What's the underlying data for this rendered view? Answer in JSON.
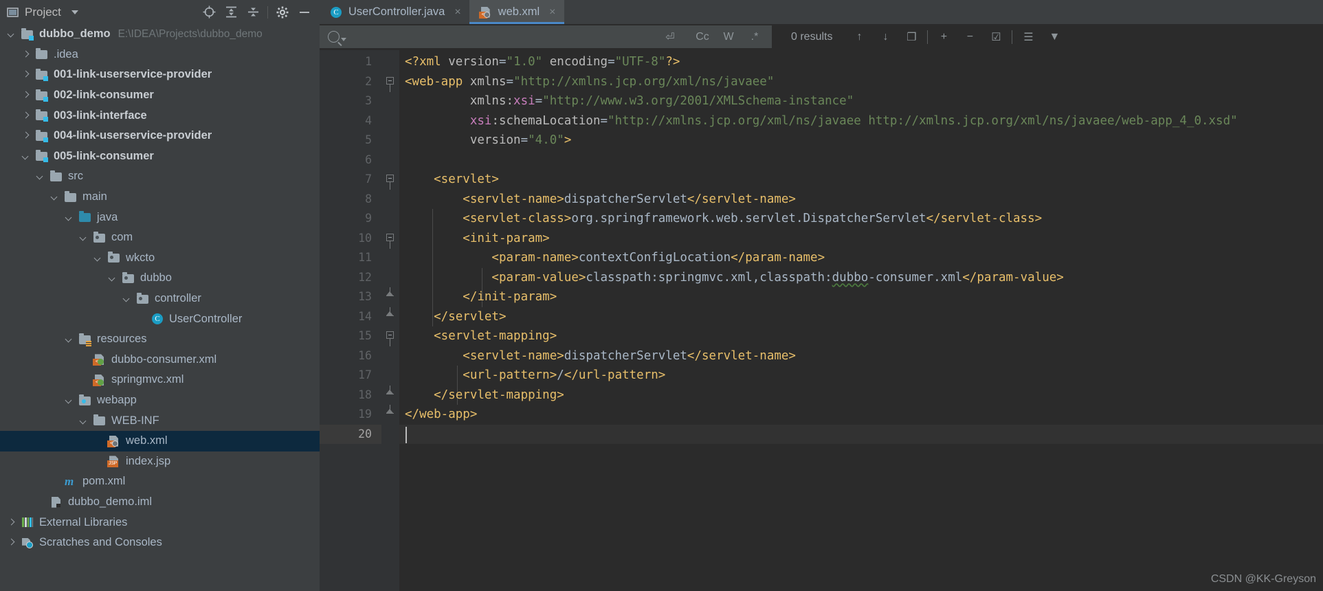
{
  "project_panel": {
    "title": "Project",
    "toolbar": [
      {
        "name": "locate-icon",
        "label": "⊕"
      },
      {
        "name": "expand-all-icon",
        "label": "⤒"
      },
      {
        "name": "collapse-all-icon",
        "label": "⤓"
      },
      {
        "name": "settings-gear-icon",
        "label": "⚙"
      },
      {
        "name": "hide-panel-icon",
        "label": "—"
      }
    ],
    "tree": [
      {
        "label": "dubbo_demo",
        "sublabel": "E:\\IDEA\\Projects\\dubbo_demo",
        "indent": 0,
        "twisty": "down",
        "icon": "module-folder-icon",
        "bold": true,
        "selected": false
      },
      {
        "label": ".idea",
        "sublabel": "",
        "indent": 1,
        "twisty": "right",
        "icon": "folder-icon",
        "bold": false,
        "selected": false
      },
      {
        "label": "001-link-userservice-provider",
        "sublabel": "",
        "indent": 1,
        "twisty": "right",
        "icon": "module-folder-icon",
        "bold": true,
        "selected": false
      },
      {
        "label": "002-link-consumer",
        "sublabel": "",
        "indent": 1,
        "twisty": "right",
        "icon": "module-folder-icon",
        "bold": true,
        "selected": false
      },
      {
        "label": "003-link-interface",
        "sublabel": "",
        "indent": 1,
        "twisty": "right",
        "icon": "module-folder-icon",
        "bold": true,
        "selected": false
      },
      {
        "label": "004-link-userservice-provider",
        "sublabel": "",
        "indent": 1,
        "twisty": "right",
        "icon": "module-folder-icon",
        "bold": true,
        "selected": false
      },
      {
        "label": "005-link-consumer",
        "sublabel": "",
        "indent": 1,
        "twisty": "down",
        "icon": "module-folder-icon",
        "bold": true,
        "selected": false
      },
      {
        "label": "src",
        "sublabel": "",
        "indent": 2,
        "twisty": "down",
        "icon": "folder-icon",
        "bold": false,
        "selected": false
      },
      {
        "label": "main",
        "sublabel": "",
        "indent": 3,
        "twisty": "down",
        "icon": "folder-icon",
        "bold": false,
        "selected": false
      },
      {
        "label": "java",
        "sublabel": "",
        "indent": 4,
        "twisty": "down",
        "icon": "source-folder-icon",
        "bold": false,
        "selected": false
      },
      {
        "label": "com",
        "sublabel": "",
        "indent": 5,
        "twisty": "down",
        "icon": "package-icon",
        "bold": false,
        "selected": false
      },
      {
        "label": "wkcto",
        "sublabel": "",
        "indent": 6,
        "twisty": "down",
        "icon": "package-icon",
        "bold": false,
        "selected": false
      },
      {
        "label": "dubbo",
        "sublabel": "",
        "indent": 7,
        "twisty": "down",
        "icon": "package-icon",
        "bold": false,
        "selected": false
      },
      {
        "label": "controller",
        "sublabel": "",
        "indent": 8,
        "twisty": "down",
        "icon": "package-icon",
        "bold": false,
        "selected": false
      },
      {
        "label": "UserController",
        "sublabel": "",
        "indent": 9,
        "twisty": "none",
        "icon": "java-class-icon",
        "bold": false,
        "selected": false
      },
      {
        "label": "resources",
        "sublabel": "",
        "indent": 4,
        "twisty": "down",
        "icon": "resources-folder-icon",
        "bold": false,
        "selected": false
      },
      {
        "label": "dubbo-consumer.xml",
        "sublabel": "",
        "indent": 5,
        "twisty": "none",
        "icon": "spring-xml-icon",
        "bold": false,
        "selected": false
      },
      {
        "label": "springmvc.xml",
        "sublabel": "",
        "indent": 5,
        "twisty": "none",
        "icon": "spring-xml-icon",
        "bold": false,
        "selected": false
      },
      {
        "label": "webapp",
        "sublabel": "",
        "indent": 4,
        "twisty": "down",
        "icon": "web-folder-icon",
        "bold": false,
        "selected": false
      },
      {
        "label": "WEB-INF",
        "sublabel": "",
        "indent": 5,
        "twisty": "down",
        "icon": "folder-icon",
        "bold": false,
        "selected": false
      },
      {
        "label": "web.xml",
        "sublabel": "",
        "indent": 6,
        "twisty": "none",
        "icon": "web-xml-icon",
        "bold": false,
        "selected": true
      },
      {
        "label": "index.jsp",
        "sublabel": "",
        "indent": 6,
        "twisty": "none",
        "icon": "jsp-icon",
        "bold": false,
        "selected": false
      },
      {
        "label": "pom.xml",
        "sublabel": "",
        "indent": 3,
        "twisty": "none",
        "icon": "maven-icon",
        "bold": false,
        "selected": false
      },
      {
        "label": "dubbo_demo.iml",
        "sublabel": "",
        "indent": 2,
        "twisty": "none",
        "icon": "iml-icon",
        "bold": false,
        "selected": false
      },
      {
        "label": "External Libraries",
        "sublabel": "",
        "indent": 0,
        "twisty": "right",
        "icon": "libraries-icon",
        "bold": false,
        "selected": false
      },
      {
        "label": "Scratches and Consoles",
        "sublabel": "",
        "indent": 0,
        "twisty": "right",
        "icon": "scratches-icon",
        "bold": false,
        "selected": false
      }
    ]
  },
  "editor": {
    "tabs": [
      {
        "label": "UserController.java",
        "icon": "java-class-icon",
        "active": false,
        "close": "×"
      },
      {
        "label": "web.xml",
        "icon": "web-xml-icon",
        "active": true,
        "close": "×"
      }
    ],
    "find_bar": {
      "placeholder": "",
      "value": "",
      "search_icon": "search-icon",
      "buttons": [
        {
          "name": "regex-history-icon",
          "label": "⏎"
        },
        {
          "name": "match-case-button",
          "label": "Cc"
        },
        {
          "name": "words-button",
          "label": "W"
        },
        {
          "name": "regex-button",
          "label": ".*"
        }
      ],
      "results_text": "0 results",
      "nav_buttons": [
        {
          "name": "find-previous-icon",
          "label": "↑"
        },
        {
          "name": "find-next-icon",
          "label": "↓"
        },
        {
          "name": "select-all-occurrences-icon",
          "label": "❐"
        }
      ],
      "scope_buttons": [
        {
          "name": "add-line-icon",
          "label": "+"
        },
        {
          "name": "remove-line-icon",
          "label": "−"
        },
        {
          "name": "select-lines-icon",
          "label": "☑"
        }
      ],
      "right_buttons": [
        {
          "name": "find-in-selection-icon",
          "label": "☰"
        },
        {
          "name": "filter-icon",
          "label": "▼"
        }
      ]
    },
    "line_numbers": [
      "1",
      "2",
      "3",
      "4",
      "5",
      "6",
      "7",
      "8",
      "9",
      "10",
      "11",
      "12",
      "13",
      "14",
      "15",
      "16",
      "17",
      "18",
      "19",
      "20"
    ],
    "current_line": 20,
    "code_lines": [
      {
        "n": 1,
        "indent": 0,
        "segments": [
          {
            "t": "<?xml ",
            "c": "pi"
          },
          {
            "t": "version",
            "c": "attrname"
          },
          {
            "t": "=",
            "c": "punct"
          },
          {
            "t": "\"1.0\"",
            "c": "str"
          },
          {
            "t": " ",
            "c": "punct"
          },
          {
            "t": "encoding",
            "c": "attrname"
          },
          {
            "t": "=",
            "c": "punct"
          },
          {
            "t": "\"UTF-8\"",
            "c": "str"
          },
          {
            "t": "?>",
            "c": "pi"
          }
        ]
      },
      {
        "n": 2,
        "indent": 0,
        "segments": [
          {
            "t": "<web-app",
            "c": "tagname"
          },
          {
            "t": " ",
            "c": "punct"
          },
          {
            "t": "xmlns",
            "c": "attrname"
          },
          {
            "t": "=",
            "c": "punct"
          },
          {
            "t": "\"http://xmlns.jcp.org/xml/ns/javaee\"",
            "c": "str"
          }
        ]
      },
      {
        "n": 3,
        "indent": 0,
        "segments": [
          {
            "t": "         ",
            "c": "punct"
          },
          {
            "t": "xmlns:",
            "c": "attrname"
          },
          {
            "t": "xsi",
            "c": "nsprefix"
          },
          {
            "t": "=",
            "c": "punct"
          },
          {
            "t": "\"http://www.w3.org/2001/XMLSchema-instance\"",
            "c": "str"
          }
        ]
      },
      {
        "n": 4,
        "indent": 0,
        "segments": [
          {
            "t": "         ",
            "c": "punct"
          },
          {
            "t": "xsi",
            "c": "nsprefix"
          },
          {
            "t": ":schemaLocation",
            "c": "attrname"
          },
          {
            "t": "=",
            "c": "punct"
          },
          {
            "t": "\"http://xmlns.jcp.org/xml/ns/javaee http://xmlns.jcp.org/xml/ns/javaee/web-app_4_0.xsd\"",
            "c": "str"
          }
        ]
      },
      {
        "n": 5,
        "indent": 0,
        "segments": [
          {
            "t": "         ",
            "c": "punct"
          },
          {
            "t": "version",
            "c": "attrname"
          },
          {
            "t": "=",
            "c": "punct"
          },
          {
            "t": "\"4.0\"",
            "c": "str"
          },
          {
            "t": ">",
            "c": "tagname"
          }
        ]
      },
      {
        "n": 6,
        "indent": 0,
        "segments": []
      },
      {
        "n": 7,
        "indent": 0,
        "segments": [
          {
            "t": "    <servlet>",
            "c": "tagname"
          }
        ]
      },
      {
        "n": 8,
        "indent": 0,
        "segments": [
          {
            "t": "        <servlet-name>",
            "c": "tagname"
          },
          {
            "t": "dispatcherServlet",
            "c": "txt"
          },
          {
            "t": "</servlet-name>",
            "c": "tagname"
          }
        ]
      },
      {
        "n": 9,
        "indent": 0,
        "segments": [
          {
            "t": "        <servlet-class>",
            "c": "tagname"
          },
          {
            "t": "org.springframework.web.servlet.DispatcherServlet",
            "c": "txt"
          },
          {
            "t": "</servlet-class>",
            "c": "tagname"
          }
        ]
      },
      {
        "n": 10,
        "indent": 0,
        "segments": [
          {
            "t": "        <init-param>",
            "c": "tagname"
          }
        ]
      },
      {
        "n": 11,
        "indent": 0,
        "segments": [
          {
            "t": "            <param-name>",
            "c": "tagname"
          },
          {
            "t": "contextConfigLocation",
            "c": "txt"
          },
          {
            "t": "</param-name>",
            "c": "tagname"
          }
        ]
      },
      {
        "n": 12,
        "indent": 0,
        "segments": [
          {
            "t": "            <param-value>",
            "c": "tagname"
          },
          {
            "t": "classpath:springmvc.xml,classpath:",
            "c": "txt"
          },
          {
            "t": "dubbo",
            "c": "txt squiggle"
          },
          {
            "t": "-consumer.xml",
            "c": "txt"
          },
          {
            "t": "</param-value>",
            "c": "tagname"
          }
        ]
      },
      {
        "n": 13,
        "indent": 0,
        "segments": [
          {
            "t": "        </init-param>",
            "c": "tagname"
          }
        ]
      },
      {
        "n": 14,
        "indent": 0,
        "segments": [
          {
            "t": "    </servlet>",
            "c": "tagname"
          }
        ]
      },
      {
        "n": 15,
        "indent": 0,
        "segments": [
          {
            "t": "    <servlet-mapping>",
            "c": "tagname"
          }
        ]
      },
      {
        "n": 16,
        "indent": 0,
        "segments": [
          {
            "t": "        <servlet-name>",
            "c": "tagname"
          },
          {
            "t": "dispatcherServlet",
            "c": "txt"
          },
          {
            "t": "</servlet-name>",
            "c": "tagname"
          }
        ]
      },
      {
        "n": 17,
        "indent": 0,
        "segments": [
          {
            "t": "        <url-pattern>",
            "c": "tagname"
          },
          {
            "t": "/",
            "c": "txt"
          },
          {
            "t": "</url-pattern>",
            "c": "tagname"
          }
        ]
      },
      {
        "n": 18,
        "indent": 0,
        "segments": [
          {
            "t": "    </servlet-mapping>",
            "c": "tagname"
          }
        ]
      },
      {
        "n": 19,
        "indent": 0,
        "segments": [
          {
            "t": "</web-app>",
            "c": "tagname"
          }
        ]
      },
      {
        "n": 20,
        "indent": 0,
        "segments": []
      }
    ]
  },
  "watermark": "CSDN @KK-Greyson",
  "colors": {
    "panel_bg": "#3c3f41",
    "editor_bg": "#2b2b2b",
    "gutter_bg": "#313335",
    "selection_bg": "#0d293e",
    "tab_active_bg": "#4e5254",
    "tab_underline": "#4a88c7",
    "tag_color": "#e8bf6a",
    "string_color": "#6a8759",
    "text_color": "#a9b7c6"
  }
}
